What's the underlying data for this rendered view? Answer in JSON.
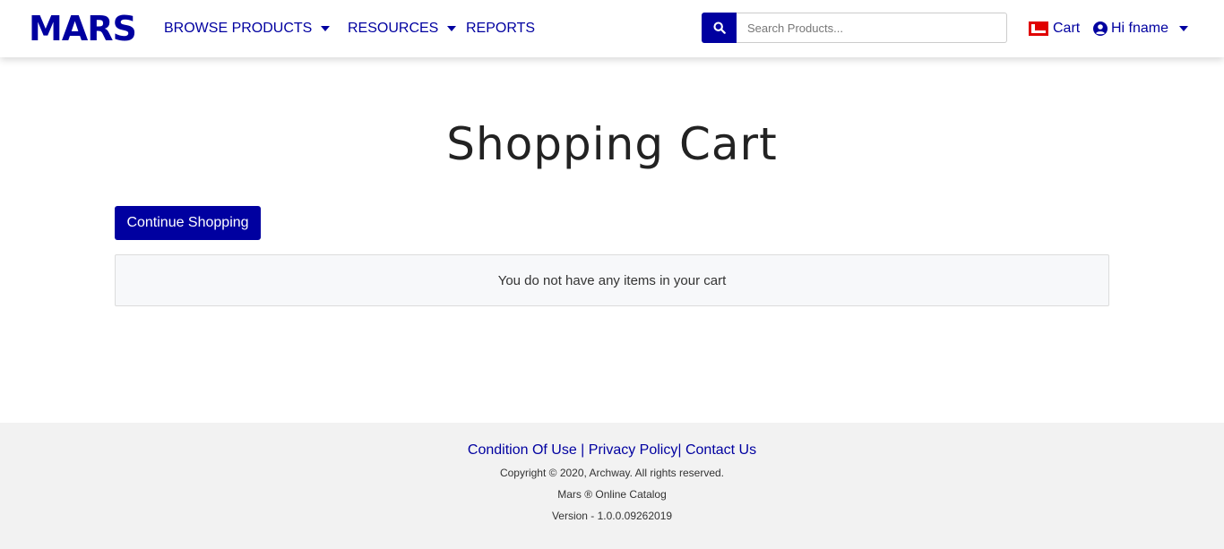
{
  "header": {
    "logo": "MARS",
    "nav": [
      {
        "label": "BROWSE PRODUCTS",
        "has_dropdown": true
      },
      {
        "label": "RESOURCES",
        "has_dropdown": true
      },
      {
        "label": "REPORTS",
        "has_dropdown": false
      }
    ],
    "search": {
      "placeholder": "Search Products...",
      "value": "",
      "icon": "search-icon"
    },
    "cart_label": "Cart",
    "user_label": "Hi fname",
    "colors": {
      "brand": "#0000a0",
      "cart_icon": "#e00000"
    }
  },
  "main": {
    "title": "Shopping Cart",
    "continue_label": "Continue Shopping",
    "empty_message": "You do not have any items in your cart"
  },
  "footer": {
    "links": [
      "Condition Of Use",
      "Privacy Policy",
      "Contact Us"
    ],
    "copyright": "Copyright © 2020, Archway. All rights reserved.",
    "catalog": "Mars ® Online Catalog",
    "version": "Version - 1.0.0.09262019"
  }
}
